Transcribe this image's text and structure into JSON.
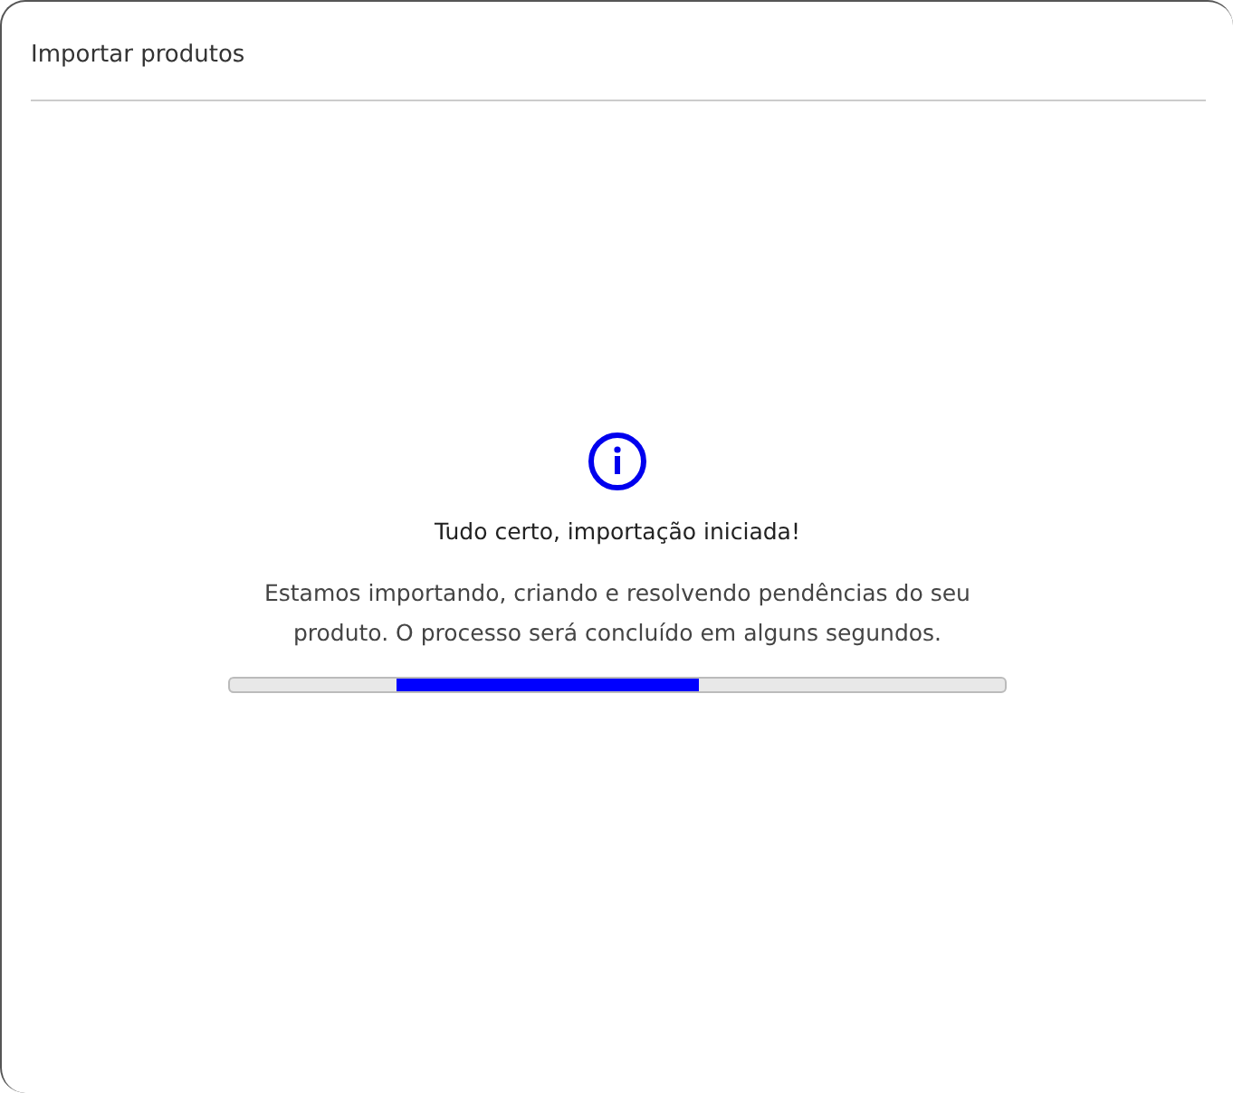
{
  "dialog": {
    "title": "Importar produtos"
  },
  "status": {
    "heading": "Tudo certo, importação iniciada!",
    "message": "Estamos importando, criando e resolvendo pendências do seu produto. O processo será concluído em alguns segundos."
  },
  "progress": {
    "indeterminate": true
  }
}
